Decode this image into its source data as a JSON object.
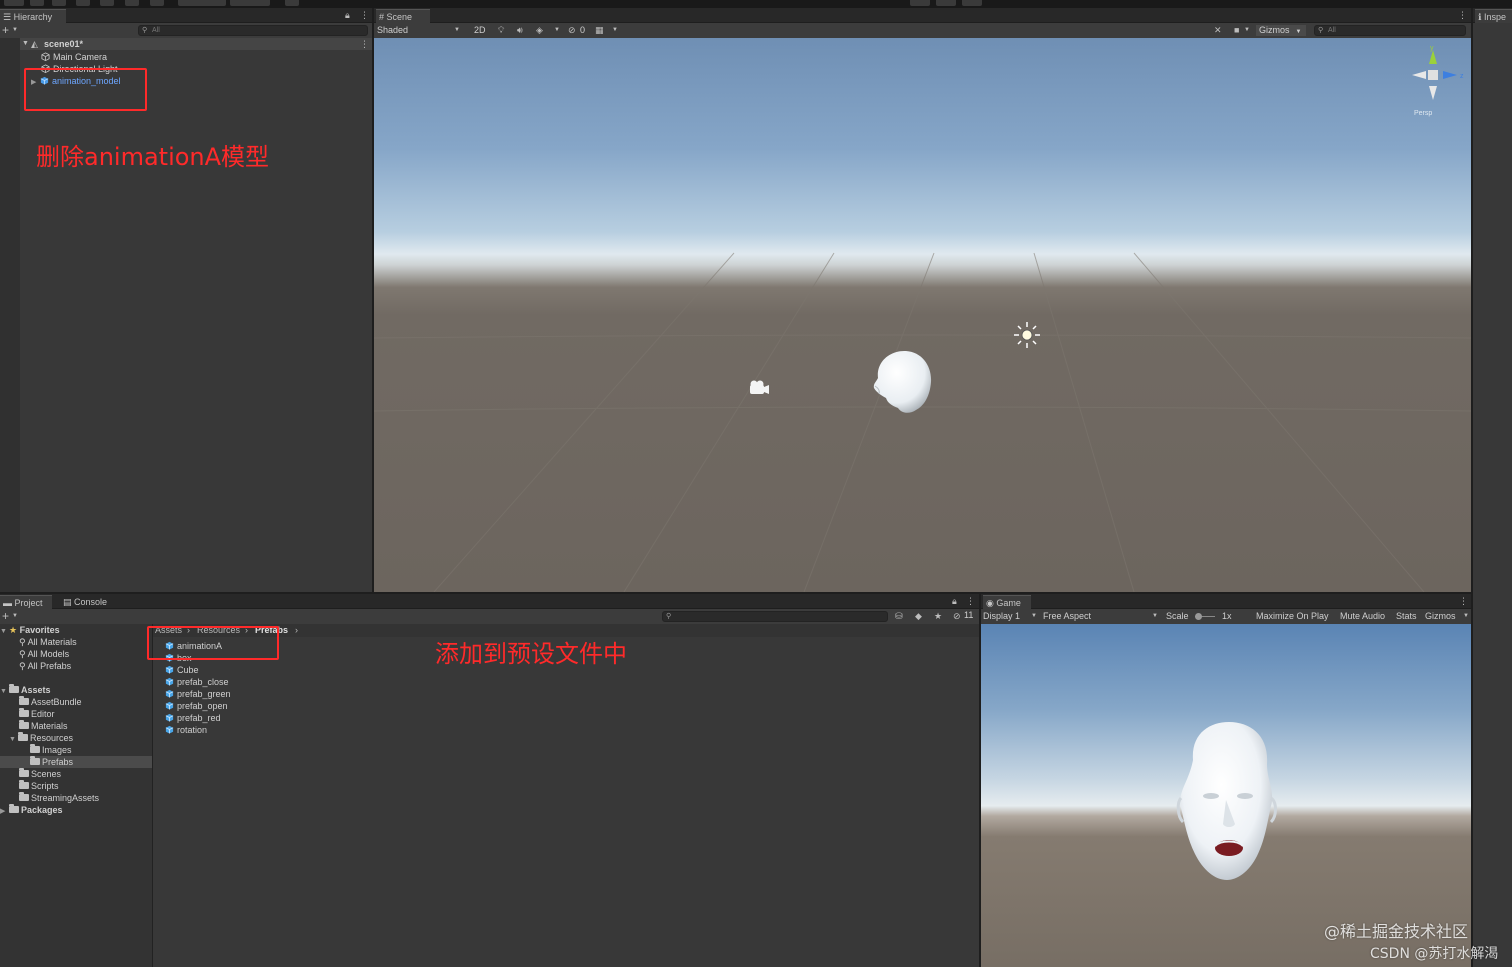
{
  "hierarchy": {
    "tab_label": "Hierarchy",
    "search_placeholder": "All",
    "scene_name": "scene01*",
    "items": [
      "Main Camera",
      "Directional Light",
      "animation_model"
    ]
  },
  "scene": {
    "tab_label": "Scene",
    "draw_mode": "Shaded",
    "mode_2d": "2D",
    "hidden_count": "0",
    "gizmos_label": "Gizmos",
    "search_placeholder": "All",
    "gizmo_axes": {
      "y": "y",
      "z": "z"
    },
    "persp_label": "Persp"
  },
  "inspector": {
    "tab_label": "Inspe"
  },
  "project": {
    "tab_project": "Project",
    "tab_console": "Console",
    "favorites_label": "Favorites",
    "favorites": [
      "All Materials",
      "All Models",
      "All Prefabs"
    ],
    "assets_label": "Assets",
    "asset_folders": [
      "AssetBundle",
      "Editor",
      "Materials"
    ],
    "resources_label": "Resources",
    "resources_children": [
      "Images",
      "Prefabs"
    ],
    "asset_folders_after": [
      "Scenes",
      "Scripts",
      "StreamingAssets"
    ],
    "packages_label": "Packages",
    "breadcrumb": [
      "Assets",
      "Resources",
      "Prefabs"
    ],
    "files": [
      "animationA",
      "box",
      "Cube",
      "prefab_close",
      "prefab_green",
      "prefab_open",
      "prefab_red",
      "rotation"
    ],
    "hidden_count": "11"
  },
  "game": {
    "tab_label": "Game",
    "display": "Display 1",
    "aspect": "Free Aspect",
    "scale_label": "Scale",
    "scale_value": "1x",
    "maximize": "Maximize On Play",
    "mute": "Mute Audio",
    "stats": "Stats",
    "gizmos": "Gizmos"
  },
  "annotations": {
    "delete_model": "删除animationA模型",
    "add_to_prefab": "添加到预设文件中"
  },
  "watermark": {
    "line1": "@稀土掘金技术社区",
    "line2": "CSDN @苏打水解渴"
  },
  "colors": {
    "annotation_red": "#ff2a2a",
    "prefab_blue": "#6da6ff",
    "panel_dark": "#383838"
  }
}
